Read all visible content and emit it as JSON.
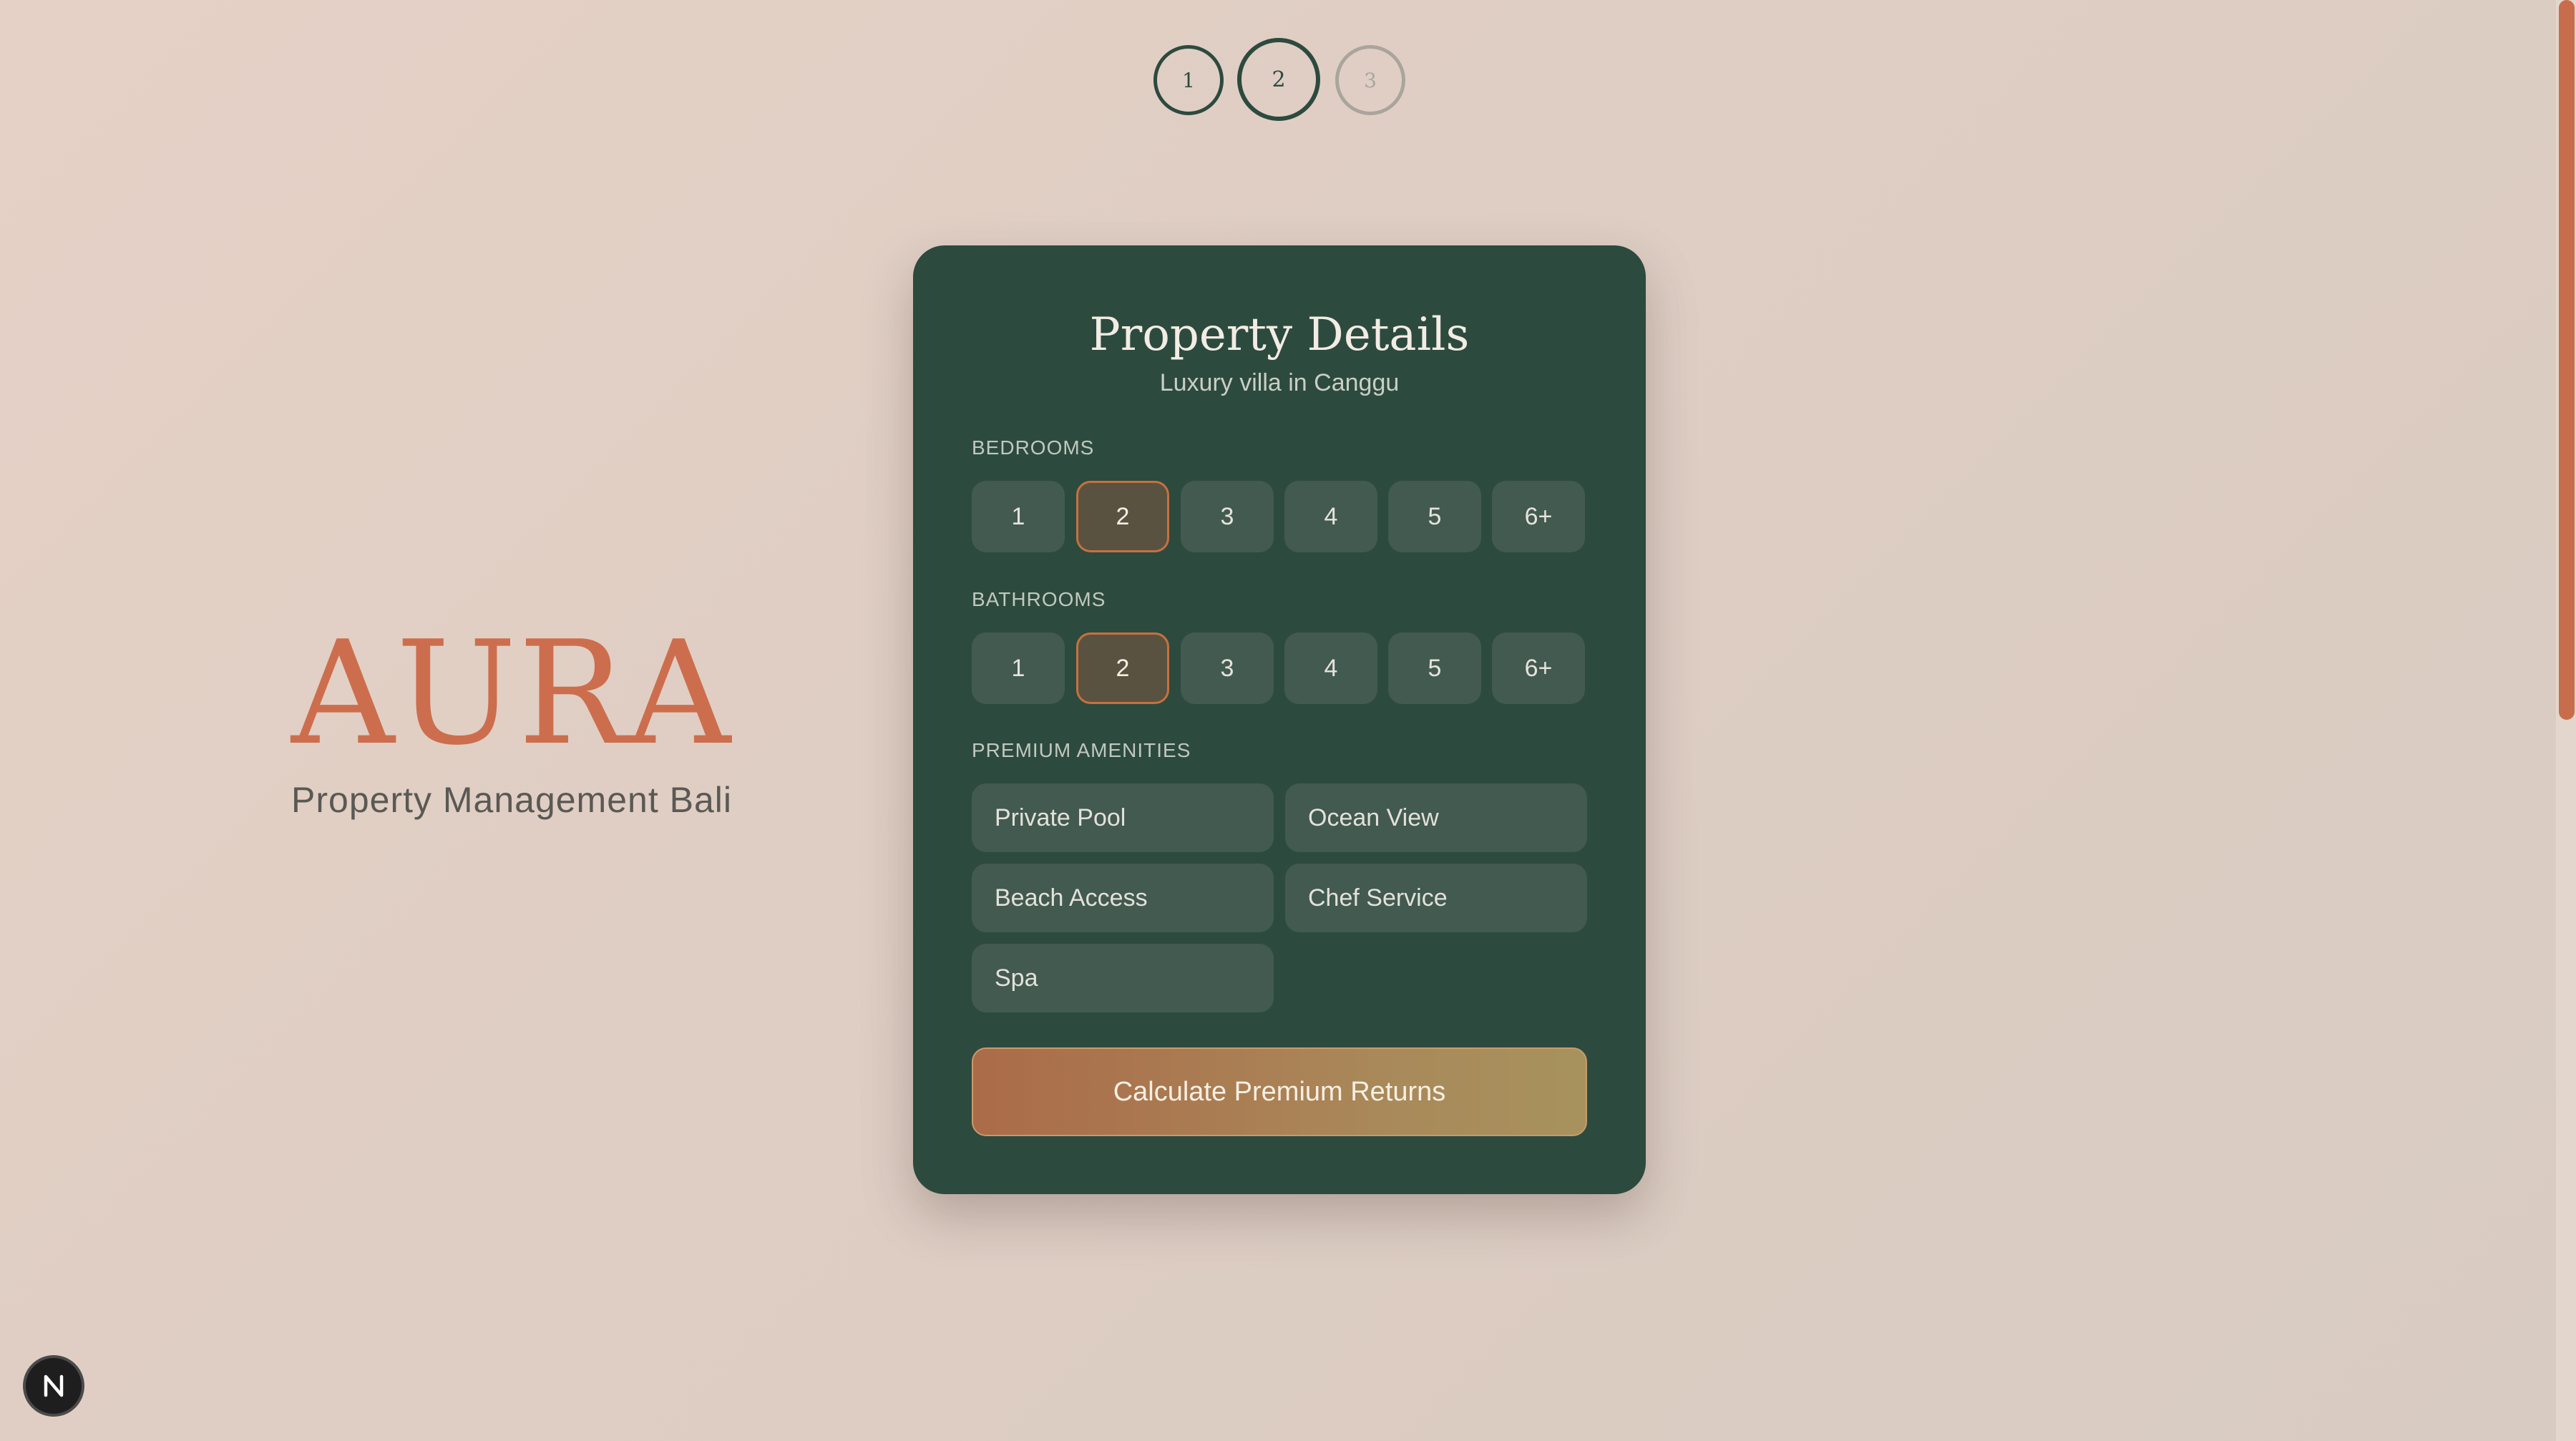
{
  "stepper": {
    "steps": [
      {
        "label": "1",
        "state": "completed"
      },
      {
        "label": "2",
        "state": "current"
      },
      {
        "label": "3",
        "state": "upcoming"
      }
    ]
  },
  "brand": {
    "name": "AURA",
    "tagline": "Property Management Bali"
  },
  "card": {
    "title": "Property Details",
    "subtitle": "Luxury villa in Canggu",
    "bedrooms": {
      "label": "BEDROOMS",
      "options": [
        "1",
        "2",
        "3",
        "4",
        "5",
        "6+"
      ],
      "selected": "2"
    },
    "bathrooms": {
      "label": "BATHROOMS",
      "options": [
        "1",
        "2",
        "3",
        "4",
        "5",
        "6+"
      ],
      "selected": "2"
    },
    "amenities": {
      "label": "PREMIUM AMENITIES",
      "items": [
        "Private Pool",
        "Ocean View",
        "Beach Access",
        "Chef Service",
        "Spa"
      ]
    },
    "cta_label": "Calculate Premium Returns"
  },
  "colors": {
    "accent": "#cc6e4d",
    "card_bg": "#2d4a3e",
    "selected_border": "#c5713f",
    "background": "#e6d1c6"
  },
  "icons": {
    "floating_badge": "n-logo-icon"
  }
}
